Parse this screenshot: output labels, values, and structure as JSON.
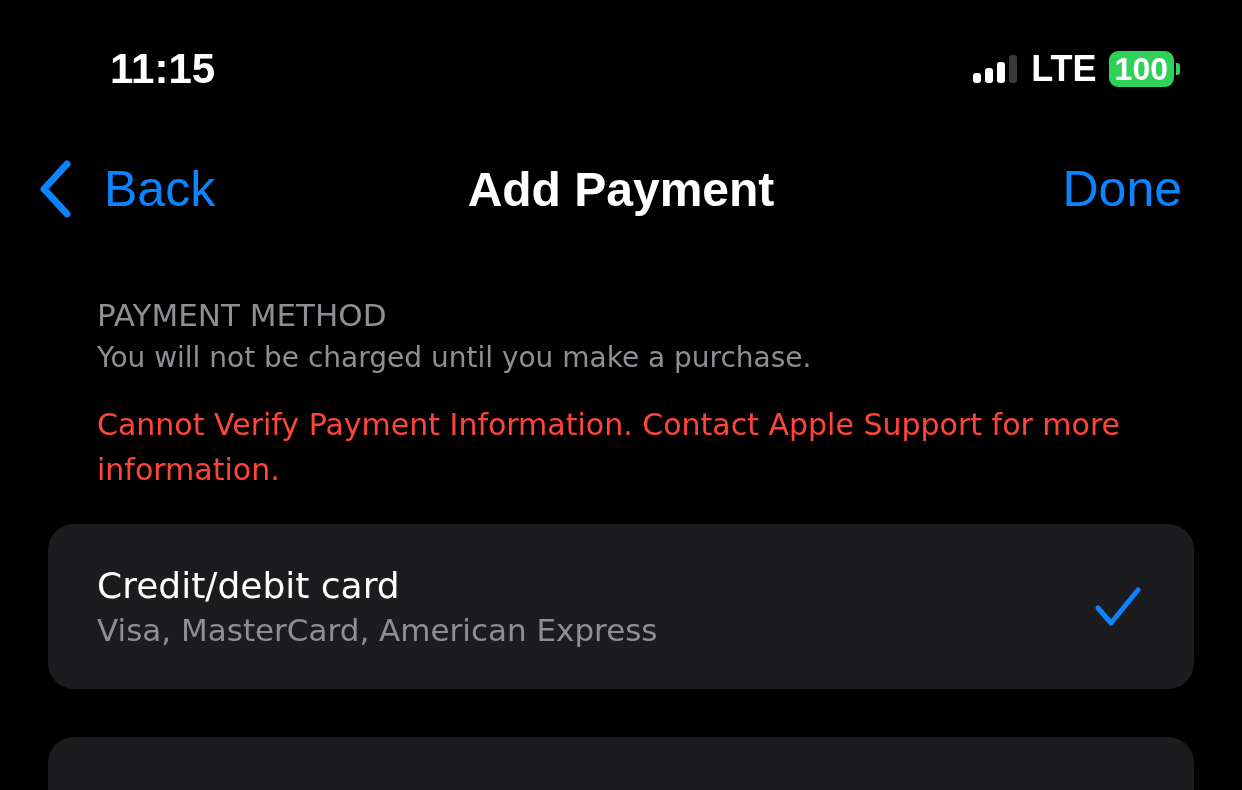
{
  "status_bar": {
    "time": "11:15",
    "network": "LTE",
    "battery": "100"
  },
  "nav_bar": {
    "back": "Back",
    "title": "Add Payment",
    "done": "Done"
  },
  "section": {
    "header": "PAYMENT METHOD",
    "subtitle": "You will not be charged until you make a purchase.",
    "error": "Cannot Verify Payment Information. Contact Apple Support for more information."
  },
  "payment_methods": [
    {
      "title": "Credit/debit card",
      "subtitle": "Visa, MasterCard, American Express",
      "selected": true
    }
  ]
}
